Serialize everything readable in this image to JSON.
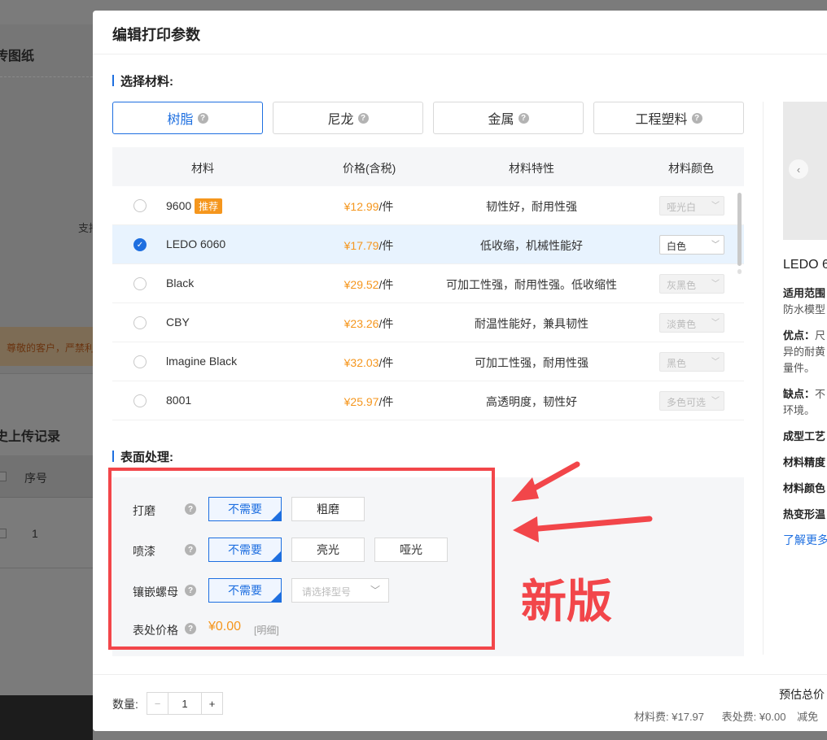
{
  "background": {
    "title": "传图纸",
    "support": "支持",
    "warning": "尊敬的客户，严禁利",
    "history_title": "史上传记录",
    "seq_header": "序号",
    "row_number": "1"
  },
  "modal": {
    "title": "编辑打印参数",
    "material_section": "选择材料:",
    "surface_section": "表面处理:"
  },
  "tabs": [
    {
      "label": "树脂",
      "active": true
    },
    {
      "label": "尼龙",
      "active": false
    },
    {
      "label": "金属",
      "active": false
    },
    {
      "label": "工程塑料",
      "active": false
    }
  ],
  "table": {
    "headers": {
      "material": "材料",
      "price": "价格(含税)",
      "feature": "材料特性",
      "color": "材料颜色"
    },
    "rows": [
      {
        "name": "9600",
        "tag": "推荐",
        "price": "¥12.99",
        "unit": "/件",
        "feature": "韧性好，耐用性强",
        "color": "哑光白",
        "selected": false
      },
      {
        "name": "LEDO 6060",
        "tag": "",
        "price": "¥17.79",
        "unit": "/件",
        "feature": "低收缩，机械性能好",
        "color": "白色",
        "selected": true
      },
      {
        "name": "Black",
        "tag": "",
        "price": "¥29.52",
        "unit": "/件",
        "feature": "可加工性强，耐用性强。低收缩性",
        "color": "灰黑色",
        "selected": false
      },
      {
        "name": "CBY",
        "tag": "",
        "price": "¥23.26",
        "unit": "/件",
        "feature": "耐温性能好，兼具韧性",
        "color": "淡黄色",
        "selected": false
      },
      {
        "name": "lmagine Black",
        "tag": "",
        "price": "¥32.03",
        "unit": "/件",
        "feature": "可加工性强，耐用性强",
        "color": "黑色",
        "selected": false
      },
      {
        "name": "8001",
        "tag": "",
        "price": "¥25.97",
        "unit": "/件",
        "feature": "高透明度，韧性好",
        "color": "多色可选",
        "selected": false
      }
    ]
  },
  "surface": {
    "polish": {
      "label": "打磨",
      "options": [
        "不需要",
        "粗磨"
      ]
    },
    "paint": {
      "label": "喷漆",
      "options": [
        "不需要",
        "亮光",
        "哑光"
      ]
    },
    "insert": {
      "label": "镶嵌螺母",
      "option": "不需要",
      "select_placeholder": "请选择型号"
    },
    "price_label": "表处价格",
    "price_value": "¥0.00",
    "detail_link": "[明细]"
  },
  "annotation": {
    "text": "新版",
    "color": "#f2464a"
  },
  "right_panel": {
    "prev_icon": "‹",
    "title": "LEDO 6",
    "lines": [
      {
        "label": "适用范围",
        "text": ""
      },
      {
        "label": "",
        "text": "防水模型"
      },
      {
        "label": "优点：",
        "text": "尺"
      },
      {
        "label": "",
        "text": "异的耐黄"
      },
      {
        "label": "",
        "text": "量件。"
      },
      {
        "label": "缺点：",
        "text": "不"
      },
      {
        "label": "",
        "text": "环境。"
      },
      {
        "label": "成型工艺",
        "text": ""
      },
      {
        "label": "材料精度",
        "text": ""
      },
      {
        "label": "材料颜色",
        "text": ""
      },
      {
        "label": "热变形温",
        "text": ""
      }
    ],
    "link": "了解更多"
  },
  "footer": {
    "qty_label": "数量:",
    "minus": "−",
    "qty_value": "1",
    "plus": "+",
    "estimate": "预估总价",
    "material_fee_label": "材料费:",
    "material_fee": "¥17.97",
    "surface_fee_label": "表处费:",
    "surface_fee": "¥0.00",
    "discount": "减免"
  },
  "colors": {
    "accent": "#1e6fe0",
    "price": "#f5961d",
    "annotation_red": "#f2464a"
  }
}
